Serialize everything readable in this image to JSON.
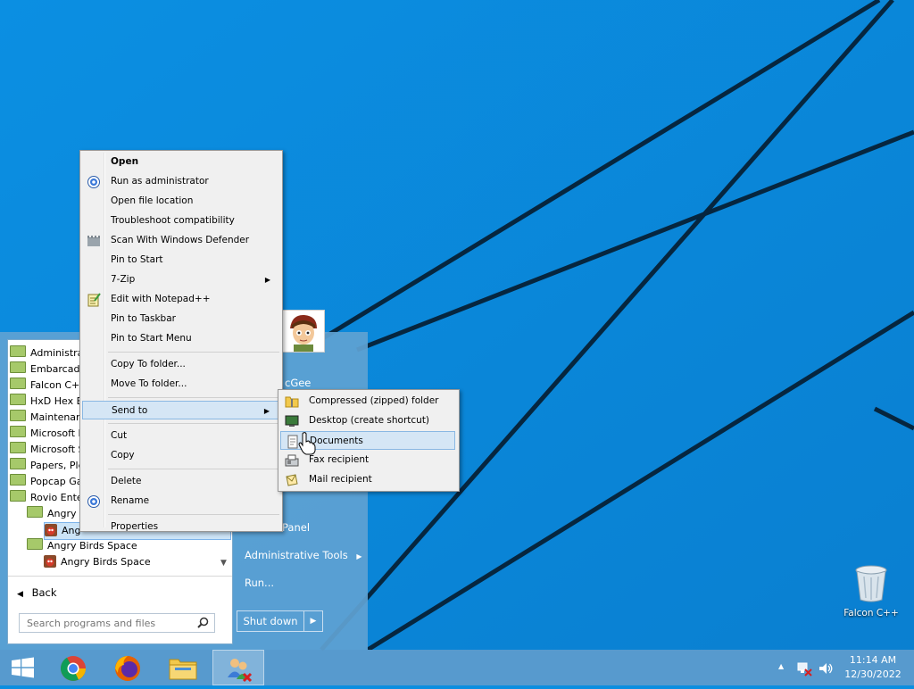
{
  "desktop": {
    "icon_label": "Falcon C++",
    "icon_name": "recycle-bin-icon"
  },
  "start_menu": {
    "programs": [
      {
        "label": "Administra",
        "kind": "folder",
        "indent": 0
      },
      {
        "label": "Embarcade",
        "kind": "folder",
        "indent": 0
      },
      {
        "label": "Falcon C++",
        "kind": "folder",
        "indent": 0
      },
      {
        "label": "HxD Hex Ed",
        "kind": "folder",
        "indent": 0
      },
      {
        "label": "Maintenan",
        "kind": "folder",
        "indent": 0
      },
      {
        "label": "Microsoft E",
        "kind": "folder",
        "indent": 0
      },
      {
        "label": "Microsoft S",
        "kind": "folder",
        "indent": 0
      },
      {
        "label": "Papers, Ple",
        "kind": "folder",
        "indent": 0
      },
      {
        "label": "Popcap Ga",
        "kind": "folder",
        "indent": 0
      },
      {
        "label": "Rovio Ente",
        "kind": "folder-open",
        "indent": 0
      },
      {
        "label": "Angry B",
        "kind": "folder-open",
        "indent": 1
      },
      {
        "label": "Ang",
        "kind": "app",
        "indent": 2,
        "selected": true
      },
      {
        "label": "Angry Birds Space",
        "kind": "folder-open",
        "indent": 1
      },
      {
        "label": "Angry Birds Space",
        "kind": "app",
        "indent": 2
      }
    ],
    "back_label": "Back",
    "search_placeholder": "Search programs and files",
    "user_name_fragment": "cGee",
    "right_items": {
      "control_panel": "Panel",
      "admin_tools": "Administrative Tools",
      "run": "Run..."
    },
    "shutdown_label": "Shut down"
  },
  "context_menu": {
    "items": [
      {
        "label": "Open",
        "bold": true
      },
      {
        "label": "Run as administrator",
        "icon": "shield-icon"
      },
      {
        "label": "Open file location"
      },
      {
        "label": "Troubleshoot compatibility"
      },
      {
        "label": "Scan With Windows Defender",
        "icon": "defender-icon"
      },
      {
        "label": "Pin to Start"
      },
      {
        "label": "7-Zip",
        "submenu": true
      },
      {
        "label": "Edit with Notepad++",
        "icon": "notepad-icon"
      },
      {
        "label": "Pin to Taskbar"
      },
      {
        "label": "Pin to Start Menu"
      },
      {
        "sep": true
      },
      {
        "label": "Copy To folder..."
      },
      {
        "label": "Move To folder..."
      },
      {
        "sep": true
      },
      {
        "label": "Send to",
        "submenu": true,
        "highlighted": true
      },
      {
        "sep": true
      },
      {
        "label": "Cut"
      },
      {
        "label": "Copy"
      },
      {
        "sep": true
      },
      {
        "label": "Delete"
      },
      {
        "label": "Rename",
        "icon": "shield-icon"
      },
      {
        "sep": true
      },
      {
        "label": "Properties"
      }
    ]
  },
  "sendto_menu": {
    "items": [
      {
        "label": "Compressed (zipped) folder",
        "icon": "zip-folder-icon"
      },
      {
        "label": "Desktop (create shortcut)",
        "icon": "desktop-icon"
      },
      {
        "label": "Documents",
        "icon": "documents-icon",
        "highlighted": true
      },
      {
        "label": "Fax recipient",
        "icon": "fax-icon"
      },
      {
        "label": "Mail recipient",
        "icon": "mail-icon"
      }
    ]
  },
  "taskbar": {
    "apps": [
      "start-button",
      "chrome-icon",
      "firefox-icon",
      "file-explorer-icon",
      "network-users-icon"
    ],
    "clock_time": "11:14 AM",
    "clock_date": "12/30/2022"
  },
  "colors": {
    "wallpaper": "#0a8ee0",
    "menu_highlight": "#d5e6f5",
    "taskbar": "#5a9bcd"
  }
}
